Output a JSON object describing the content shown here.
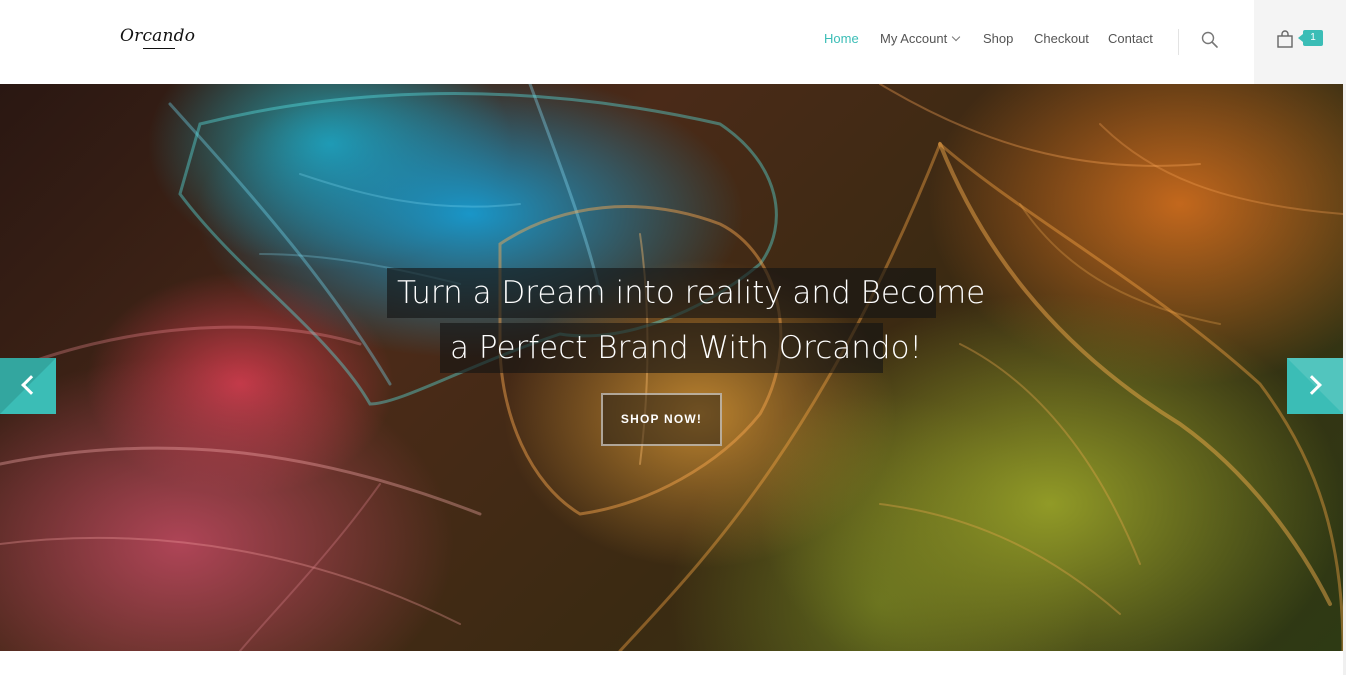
{
  "header": {
    "logo_text": "Orcando",
    "nav": [
      {
        "label": "Home",
        "active": true
      },
      {
        "label": "My Account",
        "has_dropdown": true
      },
      {
        "label": "Shop"
      },
      {
        "label": "Checkout"
      },
      {
        "label": "Contact"
      }
    ],
    "search_icon": "search-icon",
    "cart_icon": "shopping-bag-icon",
    "cart_count": "1"
  },
  "hero": {
    "headline_line1": "Turn a Dream into reality and Become",
    "headline_line2": "a Perfect Brand With Orcando!",
    "cta_label": "SHOP NOW!",
    "prev_icon": "chevron-left-icon",
    "next_icon": "chevron-right-icon"
  },
  "colors": {
    "accent": "#3bbdb6",
    "nav_text": "#555555"
  }
}
